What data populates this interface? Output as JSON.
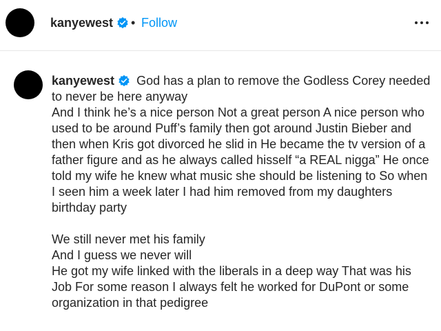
{
  "header": {
    "username": "kanyewest",
    "separator": "•",
    "follow_label": "Follow"
  },
  "post": {
    "username": "kanyewest",
    "caption_first_line": "God has a plan to remove the Godless Corey needed to never be here anyway",
    "paragraph1": "And I think he’s a nice person Not a great person A nice person who used to be around Puff’s family then got around Justin Bieber and then when Kris got divorced he slid in He became the tv version of a father figure and as he always called hisself “a REAL nigga” He once told my wife he knew what music she should be listening to So when I seen him a week later I had him removed from my daughters birthday party",
    "line_a": "We still never met his family",
    "line_b": "And I guess we never will",
    "paragraph2": "He got my wife linked with the liberals in a deep way That was his Job For some reason I always felt he worked for DuPont or some organization in that pedigree"
  },
  "icons": {
    "verified": "verified-badge-icon",
    "more": "more-options-icon"
  },
  "colors": {
    "link": "#0095f6",
    "verified": "#0095f6",
    "text": "#262626",
    "avatar": "#000000"
  }
}
